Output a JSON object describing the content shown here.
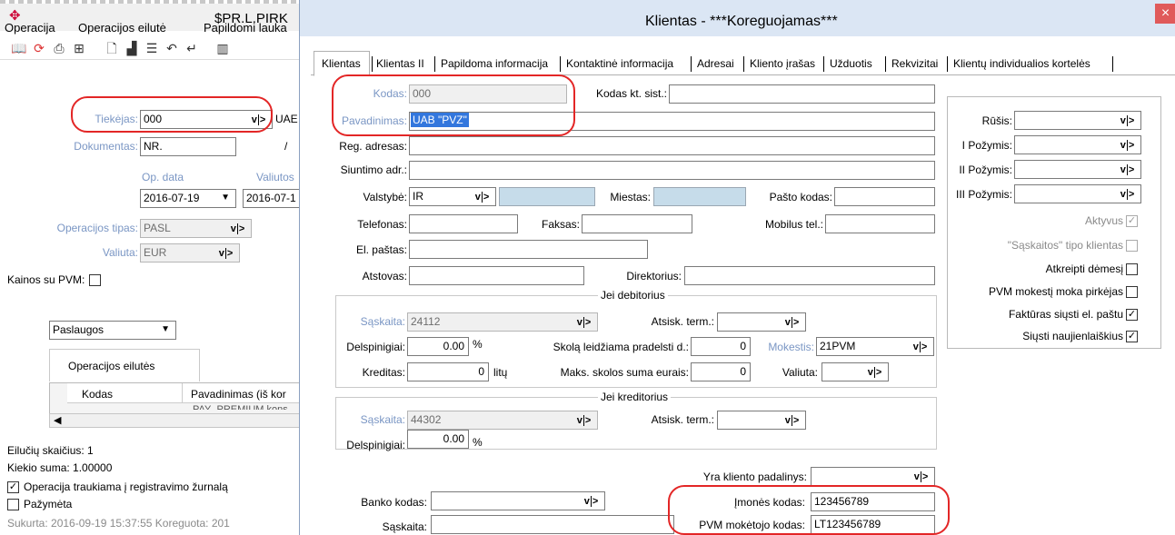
{
  "left_window": {
    "title": "$PR.L.PIRK",
    "menu": [
      "Operacija",
      "Operacijos eilutė",
      "Papildomi lauka"
    ],
    "tiekejas": {
      "label": "Tiekėjas:",
      "value": "000",
      "suffix": "UAE"
    },
    "dokumentas": {
      "label": "Dokumentas:",
      "value": "NR.",
      "slash": "/"
    },
    "op_data": {
      "label": "Op. data",
      "value": "2016-07-19"
    },
    "valiutos": {
      "label": "Valiutos",
      "value": "2016-07-1"
    },
    "operacijos_tipas": {
      "label": "Operacijos tipas:",
      "value": "PASL"
    },
    "valiuta": {
      "label": "Valiuta:",
      "value": "EUR"
    },
    "kainos_su_pvm": {
      "label": "Kainos su PVM:"
    },
    "paslaugos": {
      "value": "Paslaugos"
    },
    "operacijos_eilutes_tab": "Operacijos eilutės",
    "grid": {
      "columns": [
        "Kodas",
        "Pavadinimas (iš kor"
      ],
      "partial_row": "PAY_PREMIUM kons"
    },
    "eiluciu_skaicius": "Eilučių skaičius: 1",
    "kiekio_suma": "Kiekio suma: 1.00000",
    "traukiama": {
      "label": "Operacija traukiama į registravimo žurnalą",
      "checked": true
    },
    "pazymeta": {
      "label": "Pažymėta",
      "checked": false
    },
    "sukurta": "Sukurta: 2016-09-19 15:37:55 Koreguota: 201"
  },
  "dialog": {
    "title": "Klientas - ***Koreguojamas***",
    "close_glyph": "×",
    "tabs": [
      "Klientas",
      "Klientas II",
      "Papildoma informacija",
      "Kontaktinė informacija",
      "Adresai",
      "Kliento įrašas",
      "Užduotis",
      "Rekvizitai",
      "Klientų individualios kortelės"
    ],
    "kodas": {
      "label": "Kodas:",
      "value": "000"
    },
    "kodas_kt_sist": {
      "label": "Kodas kt. sist.:",
      "value": ""
    },
    "pavadinimas": {
      "label": "Pavadinimas:",
      "value": "UAB \"PVZ\""
    },
    "reg_adresas": {
      "label": "Reg. adresas:",
      "value": ""
    },
    "siuntimo_adr": {
      "label": "Siuntimo adr.:",
      "value": ""
    },
    "valstybe": {
      "label": "Valstybė:",
      "value": "IR"
    },
    "miestas": {
      "label": "Miestas:"
    },
    "pasto_kodas": {
      "label": "Pašto kodas:"
    },
    "telefonas": {
      "label": "Telefonas:"
    },
    "faksas": {
      "label": "Faksas:"
    },
    "mobilus": {
      "label": "Mobilus tel.:"
    },
    "el_pastas": {
      "label": "El. paštas:"
    },
    "atstovas": {
      "label": "Atstovas:"
    },
    "direktorius": {
      "label": "Direktorius:"
    },
    "debitorius": {
      "title": "Jei debitorius",
      "saskaita": {
        "label": "Sąskaita:",
        "value": "24112"
      },
      "atsisk_term": {
        "label": "Atsisk. term.:"
      },
      "delspinigiai": {
        "label": "Delspinigiai:",
        "value": "0.00",
        "unit": "%"
      },
      "skola": {
        "label": "Skolą leidžiama pradelsti d.:",
        "value": "0"
      },
      "mokestis": {
        "label": "Mokestis:",
        "value": "21PVM"
      },
      "kreditas": {
        "label": "Kreditas:",
        "value": "0",
        "unit": "litų"
      },
      "maks_skolos": {
        "label": "Maks. skolos suma eurais:",
        "value": "0"
      },
      "valiuta": {
        "label": "Valiuta:"
      }
    },
    "kreditorius": {
      "title": "Jei kreditorius",
      "saskaita": {
        "label": "Sąskaita:",
        "value": "44302"
      },
      "atsisk_term": {
        "label": "Atsisk. term.:"
      },
      "delspinigiai": {
        "label": "Delspinigiai:",
        "value": "0.00",
        "unit": "%"
      }
    },
    "padalinys": {
      "label": "Yra kliento padalinys:"
    },
    "banko_kodas": {
      "label": "Banko kodas:"
    },
    "saskaita": {
      "label": "Sąskaita:"
    },
    "imones_kodas": {
      "label": "Įmonės kodas:",
      "value": "123456789"
    },
    "pvm_kodas": {
      "label": "PVM mokėtojo kodas:",
      "value": "LT123456789"
    },
    "right_panel": {
      "rusis": "Rūšis:",
      "pozymis1": "I Požymis:",
      "pozymis2": "II Požymis:",
      "pozymis3": "III Požymis:",
      "aktyvus": {
        "label": "Aktyvus",
        "checked": true
      },
      "saskaitos_tipo": {
        "label": "\"Sąskaitos\" tipo klientas",
        "checked": false
      },
      "atkreipti": {
        "label": "Atkreipti dėmesį",
        "checked": false
      },
      "pvm_moka": {
        "label": "PVM mokestį moka pirkėjas",
        "checked": false
      },
      "fakturas": {
        "label": "Faktūras siųsti el. paštu",
        "checked": true
      },
      "naujienlaiskius": {
        "label": "Siųsti naujienlaiškius",
        "checked": true
      }
    }
  },
  "colors": {
    "accent_red": "#e32626",
    "title_bar": "#dbe6f4",
    "close_button": "#e05a5a"
  }
}
